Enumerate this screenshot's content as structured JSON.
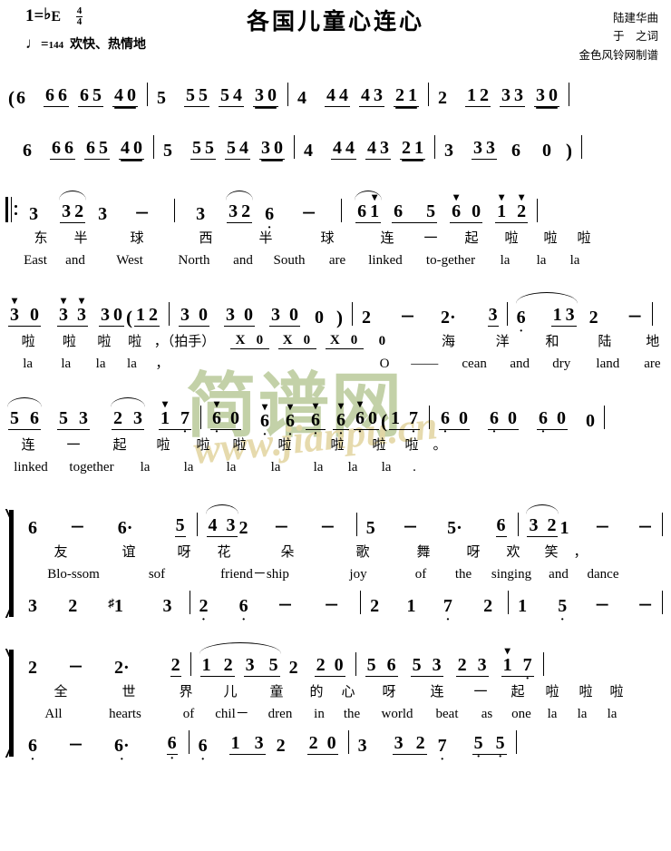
{
  "header": {
    "key_label": "1=",
    "key_accidental": "♭",
    "key_letter": "E",
    "meter_num": "4",
    "meter_den": "4",
    "tempo_note": "♩",
    "tempo_eq": "=",
    "tempo_bpm": "144",
    "tempo_mood": "欢快、热情地",
    "title": "各国儿童心连心",
    "credit_composer": "陆建华曲",
    "credit_lyricist": "于　之词",
    "credit_publisher": "金色风铃网制谱"
  },
  "watermark": {
    "cn": "简谱网",
    "url": "www.jianpu.cn"
  },
  "intro": {
    "line1": "( 6  6 6  6 5  4 0 | 5  5 5  5 4  3 0 | 4  4 4  4 3  2 1 | 2  1 2  3 3  3 0 |",
    "line2": "6  6 6  6 5  4 0 | 5  5 5  5 4  3 0 | 4  4 4  4 3  2 1 | 3  3 3  6  0 )"
  },
  "lyrics": {
    "v1_cn": [
      "东",
      "半",
      "球",
      "西",
      "半",
      "球",
      "连",
      "一",
      "起",
      "啦",
      "啦",
      "啦"
    ],
    "v1_en": [
      "East",
      "and",
      "West",
      "North",
      "and",
      "South",
      "are",
      "linked",
      "to-gether",
      "la",
      "la",
      "la"
    ],
    "v2_cn": [
      "啦",
      "啦",
      "啦",
      "啦",
      "，（拍手）",
      "海",
      "洋",
      "和",
      "陆",
      "地"
    ],
    "v2_en": [
      "la",
      "la",
      "la",
      "la",
      "，",
      "O",
      "——",
      "cean",
      "and",
      "dry",
      "land",
      "are"
    ],
    "v3_cn": [
      "连",
      "一",
      "起",
      "啦",
      "啦",
      "啦",
      "啦",
      "啦",
      "啦",
      "啦",
      "。"
    ],
    "v3_en": [
      "linked",
      "together",
      "la",
      "la",
      "la",
      "la",
      "la",
      "la",
      "la",
      "."
    ],
    "v4_cn": [
      "友",
      "谊",
      "呀",
      "花",
      "朵",
      "歌",
      "舞",
      "呀",
      "欢",
      "笑",
      "，"
    ],
    "v4_en": [
      "Blo-ssom",
      "sof",
      "friend－ship",
      "joy",
      "of",
      "the",
      "singing",
      "and",
      "dance"
    ],
    "v5_cn": [
      "全",
      "世",
      "界",
      "儿",
      "童",
      "的",
      "心",
      "呀",
      "连",
      "一",
      "起",
      "啦",
      "啦",
      "啦"
    ],
    "v5_en": [
      "All",
      "hearts",
      "of",
      "chil－",
      "dren",
      "in",
      "the",
      "world",
      "beat",
      "as",
      "one",
      "la",
      "la",
      "la"
    ],
    "clap": [
      "X",
      "0",
      "X",
      "0",
      "X",
      "0",
      "0"
    ]
  },
  "notation_symbols": {
    "repeat_start": "‖:",
    "barline": "|",
    "dash": "－",
    "rest": "0",
    "sharp": "♯",
    "paren_open": "(",
    "paren_close": ")",
    "dot": "·"
  },
  "chart_data": {
    "type": "table",
    "title": "各国儿童心连心 — 简谱 (Jianpu numbered notation)",
    "key": "1=♭E",
    "meter": "4/4",
    "tempo": "♩=144",
    "lines": [
      {
        "id": "intro-1",
        "role": "instrumental-intro",
        "measures": [
          {
            "notes": [
              "(6",
              "66",
              "65",
              "40"
            ]
          },
          {
            "notes": [
              "5",
              "55",
              "54",
              "30"
            ]
          },
          {
            "notes": [
              "4",
              "44",
              "43",
              "21"
            ]
          },
          {
            "notes": [
              "2",
              "12",
              "33",
              "30"
            ]
          }
        ]
      },
      {
        "id": "intro-2",
        "role": "instrumental-intro",
        "measures": [
          {
            "notes": [
              "6",
              "66",
              "65",
              "40"
            ]
          },
          {
            "notes": [
              "5",
              "55",
              "54",
              "30"
            ]
          },
          {
            "notes": [
              "4",
              "44",
              "43",
              "21"
            ]
          },
          {
            "notes": [
              "3",
              "33",
              "6",
              "0)"
            ]
          }
        ]
      },
      {
        "id": "verse-1",
        "role": "melody",
        "repeat_start": true,
        "measures": [
          {
            "notes": [
              "3",
              "32",
              "3",
              "-"
            ]
          },
          {
            "notes": [
              "3",
              "32",
              "6.",
              "-"
            ]
          },
          {
            "notes": [
              "6'1'",
              "6'",
              "5",
              "6'0",
              "1'2'"
            ]
          }
        ]
      },
      {
        "id": "verse-2",
        "role": "melody",
        "measures": [
          {
            "notes": [
              "3'0",
              "3'3'",
              "30",
              "(12"
            ]
          },
          {
            "notes": [
              "30",
              "30",
              "30",
              "0)"
            ]
          },
          {
            "notes": [
              "2",
              "-",
              "2.",
              "3"
            ]
          },
          {
            "notes": [
              "6.",
              "13",
              "2",
              "-"
            ]
          }
        ]
      },
      {
        "id": "verse-3",
        "role": "melody",
        "measures": [
          {
            "notes": [
              "56",
              "53",
              "23",
              "1'7"
            ]
          },
          {
            "notes": [
              "6.0",
              "6.",
              "6.",
              "6.",
              "6.0",
              "(17"
            ]
          },
          {
            "notes": [
              "6.0",
              "6.0",
              "6.0",
              "0"
            ]
          }
        ]
      },
      {
        "id": "chorus-upper",
        "role": "voice-1",
        "brace": true,
        "measures": [
          {
            "notes": [
              "6",
              "-",
              "6.",
              "5"
            ]
          },
          {
            "notes": [
              "43",
              "2",
              "-",
              "-"
            ]
          },
          {
            "notes": [
              "5",
              "-",
              "5.",
              "6"
            ]
          },
          {
            "notes": [
              "32",
              "1",
              "-",
              "-"
            ]
          }
        ]
      },
      {
        "id": "chorus-lower",
        "role": "voice-2",
        "measures": [
          {
            "notes": [
              "3",
              "2",
              "#1",
              "3"
            ]
          },
          {
            "notes": [
              "2.",
              "6.",
              "-",
              "-"
            ]
          },
          {
            "notes": [
              "2",
              "1",
              "7.",
              "2"
            ]
          },
          {
            "notes": [
              "1",
              "5.",
              "-",
              "-"
            ]
          }
        ]
      },
      {
        "id": "finale-upper",
        "role": "voice-1",
        "brace": true,
        "measures": [
          {
            "notes": [
              "2",
              "-",
              "2.",
              "2"
            ]
          },
          {
            "notes": [
              "12",
              "35",
              "2",
              "20"
            ]
          },
          {
            "notes": [
              "56",
              "53",
              "23",
              "1'7"
            ]
          }
        ]
      },
      {
        "id": "finale-lower",
        "role": "voice-2",
        "measures": [
          {
            "notes": [
              "6.",
              "-",
              "6..",
              "6.."
            ]
          },
          {
            "notes": [
              "6.",
              "13",
              "2",
              "20"
            ]
          },
          {
            "notes": [
              "3",
              "32",
              "7.",
              "5.5."
            ]
          }
        ]
      }
    ]
  }
}
